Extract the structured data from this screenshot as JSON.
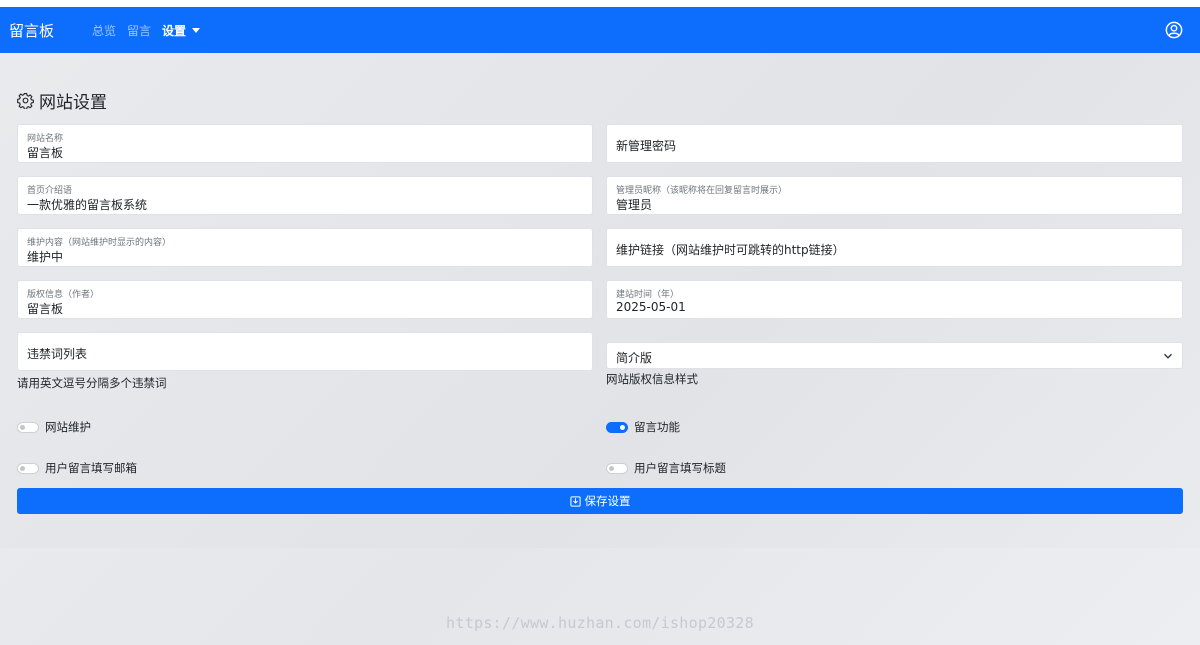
{
  "navbar": {
    "brand": "留言板",
    "links": [
      "总览",
      "留言"
    ],
    "active_dropdown": "设置",
    "user_icon": "person-circle-icon",
    "bg_color": "#0d6efd"
  },
  "page": {
    "title": "网站设置",
    "title_icon": "gear-icon"
  },
  "fields": {
    "site_name": {
      "label": "网站名称",
      "value": "留言板"
    },
    "new_password": {
      "placeholder": "新管理密码"
    },
    "intro": {
      "label": "首页介绍语",
      "value": "一款优雅的留言板系统"
    },
    "admin_nickname": {
      "label": "管理员昵称（该昵称将在回复留言时展示）",
      "value": "管理员"
    },
    "maintenance_content": {
      "label": "维护内容（网站维护时显示的内容）",
      "value": "维护中"
    },
    "maintenance_link": {
      "placeholder": "维护链接（网站维护时可跳转的http链接）"
    },
    "copyright": {
      "label": "版权信息（作者）",
      "value": "留言板"
    },
    "founded": {
      "label": "建站时间（年）",
      "value": "2025-05-01"
    },
    "banned_words": {
      "placeholder": "违禁词列表",
      "help": "请用英文逗号分隔多个违禁词"
    },
    "copyright_style": {
      "value": "简介版",
      "help": "网站版权信息样式"
    }
  },
  "switches": {
    "maintenance": {
      "label": "网站维护",
      "on": false
    },
    "messages": {
      "label": "留言功能",
      "on": true
    },
    "require_email": {
      "label": "用户留言填写邮箱",
      "on": false
    },
    "require_title": {
      "label": "用户留言填写标题",
      "on": false
    }
  },
  "save_button": {
    "label": "保存设置",
    "icon": "save-icon"
  },
  "watermark": "https://www.huzhan.com/ishop20328"
}
